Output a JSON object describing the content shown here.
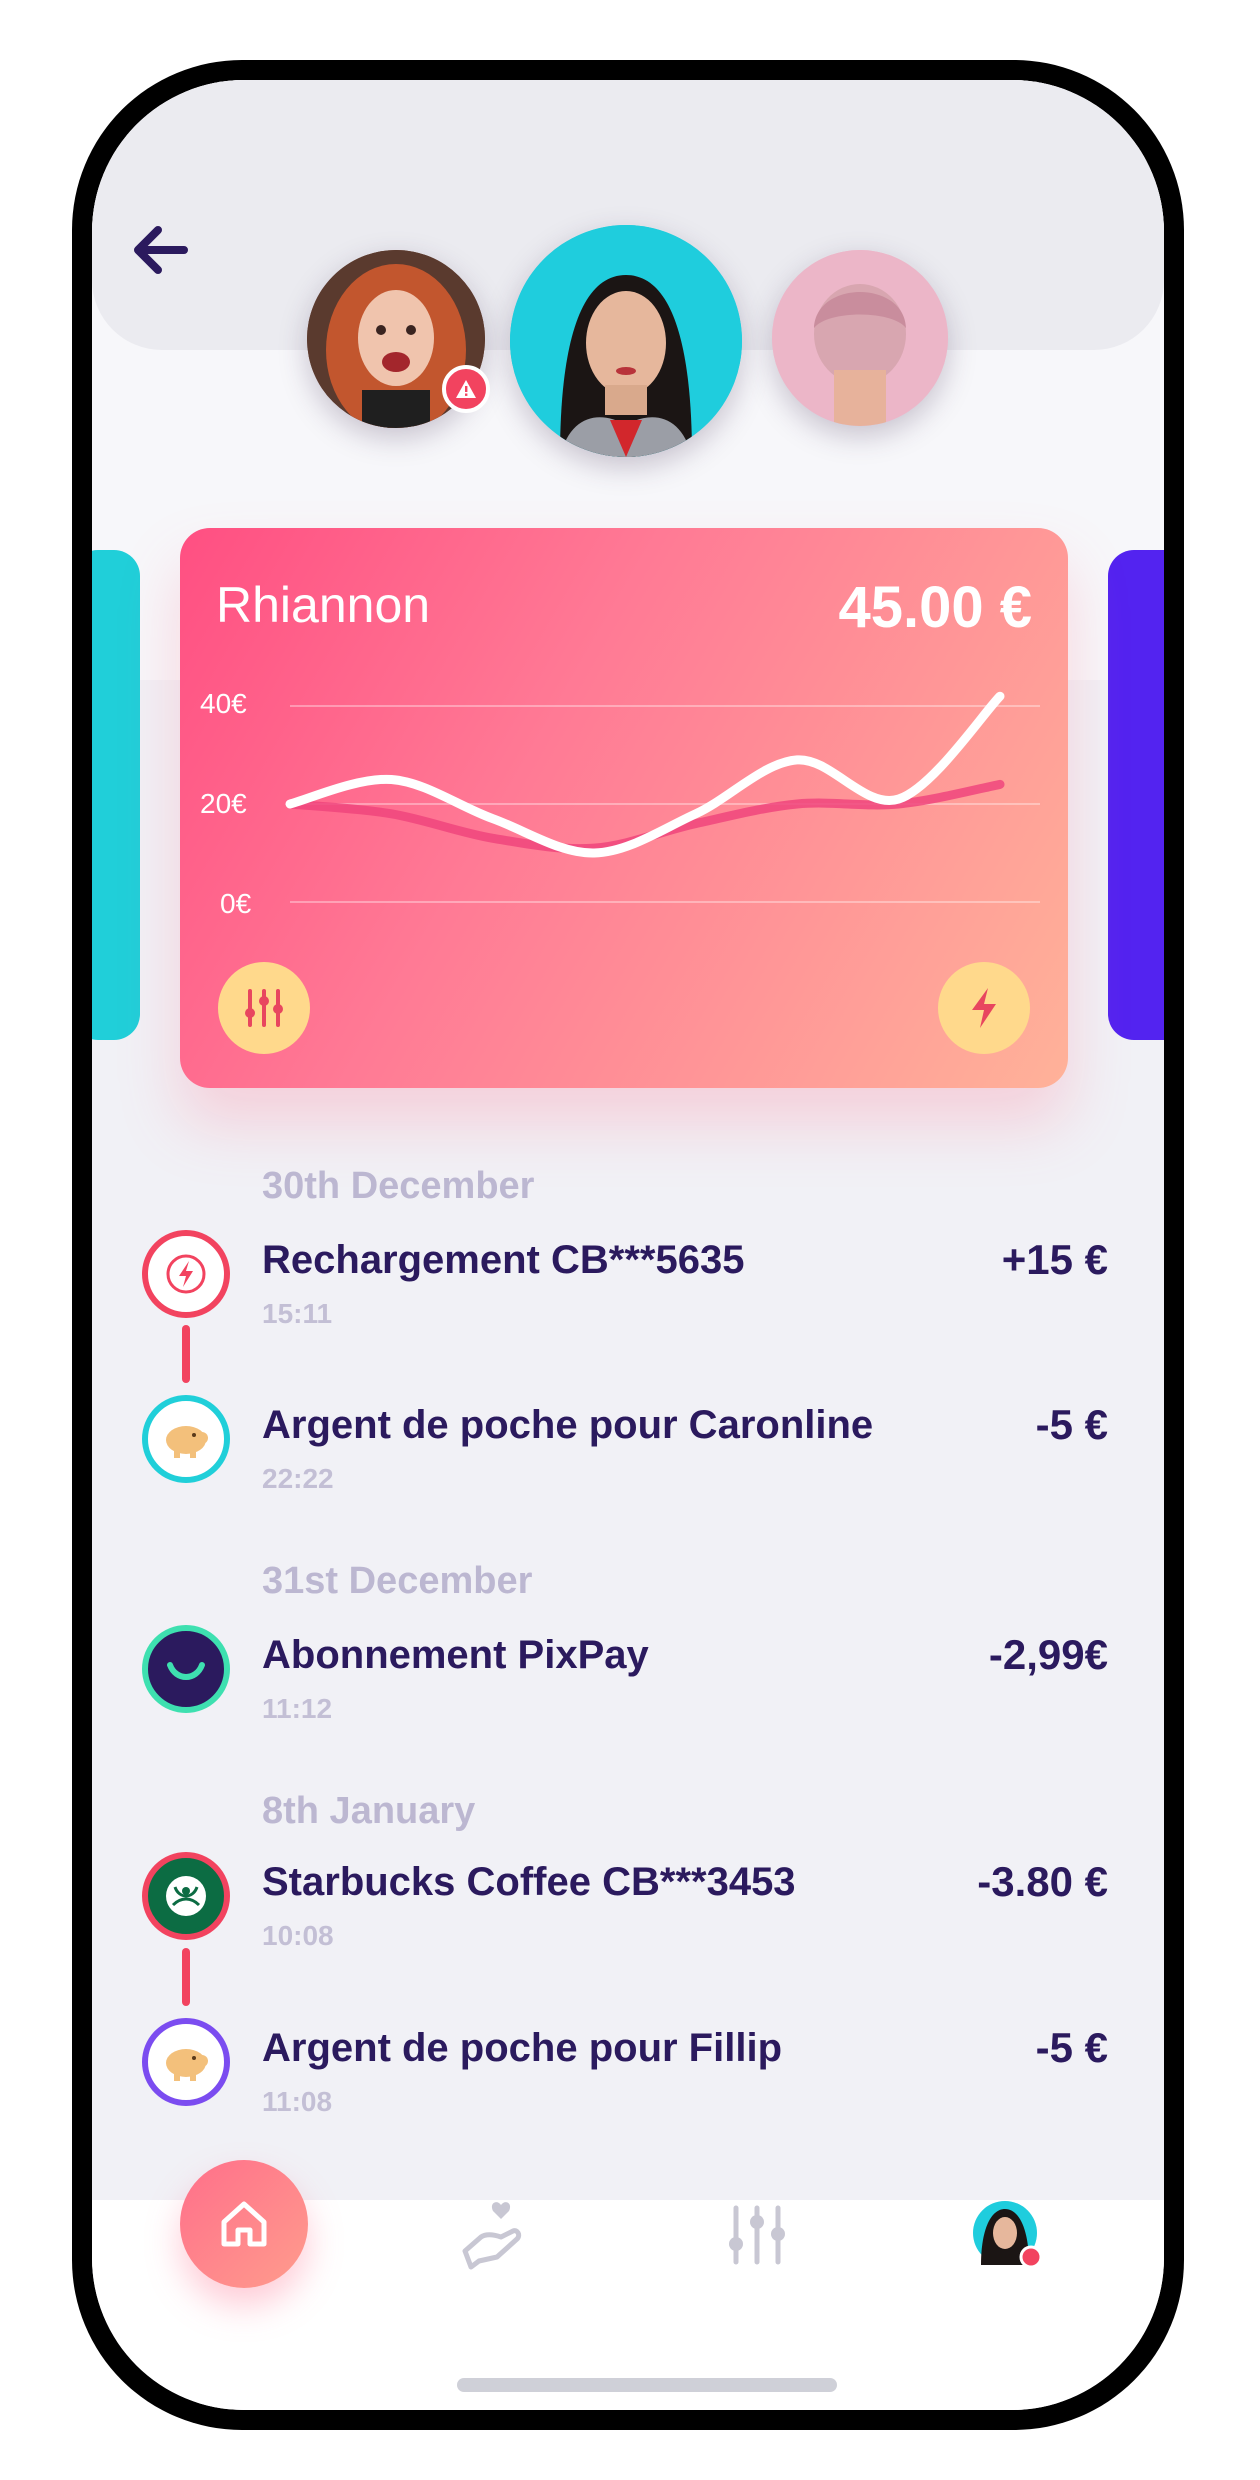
{
  "profiles": [
    {
      "name": "profile-left",
      "alert": true
    },
    {
      "name": "profile-selected"
    },
    {
      "name": "profile-right"
    }
  ],
  "card": {
    "name": "Rhiannon",
    "balance": "45.00 €",
    "y_ticks": [
      "40€",
      "20€",
      "0€"
    ]
  },
  "chart_data": {
    "type": "line",
    "y_ticks": [
      "0€",
      "20€",
      "40€"
    ],
    "ylim": [
      0,
      40
    ],
    "x": [
      0,
      1,
      2,
      3,
      4,
      5,
      6,
      7
    ],
    "series": [
      {
        "values": [
          20,
          25,
          17,
          10,
          18,
          29,
          21,
          42
        ]
      },
      {
        "values": [
          20,
          18,
          13,
          11,
          16,
          20,
          20,
          24
        ]
      }
    ],
    "grid": true
  },
  "transactions": {
    "groups": [
      {
        "date": "30th December",
        "items": [
          {
            "title": "Rechargement   CB***5635",
            "time": "15:11",
            "amount": "+15 €"
          },
          {
            "title": "Argent de poche pour Caronline",
            "time": "22:22",
            "amount": "-5 €"
          }
        ]
      },
      {
        "date": "31st December",
        "items": [
          {
            "title": "Abonnement  PixPay",
            "time": "11:12",
            "amount": "-2,99€"
          }
        ]
      },
      {
        "date": "8th January",
        "items": [
          {
            "title": "Starbucks Coffee   CB***3453",
            "time": "10:08",
            "amount": "-3.80 €"
          },
          {
            "title": "Argent de poche pour Fillip",
            "time": "11:08",
            "amount": "-5 €"
          }
        ]
      }
    ]
  },
  "nav": {
    "items": [
      "home-icon",
      "heart-hand-icon",
      "sliders-icon",
      "profile-avatar"
    ],
    "accent": "#ff6f8a",
    "muted": "#c8c7d3"
  },
  "colors": {
    "primary_text": "#2b1a5e",
    "date_text": "#bcb7d1",
    "alert": "#f2435f",
    "teal": "#20cfd9",
    "purple": "#5323f0"
  }
}
